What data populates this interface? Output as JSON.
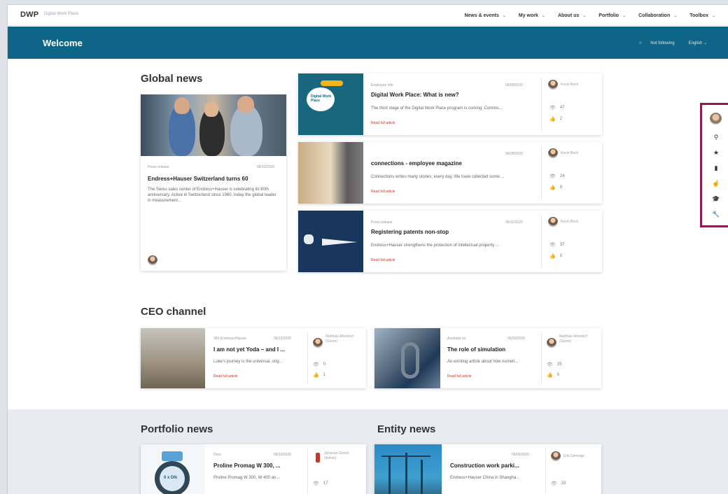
{
  "app": {
    "logo": "DWP",
    "subtitle": "Digital Work Place"
  },
  "topnav": {
    "items": [
      {
        "label": "News & events"
      },
      {
        "label": "My work"
      },
      {
        "label": "About us"
      },
      {
        "label": "Portfolio"
      },
      {
        "label": "Collaboration"
      },
      {
        "label": "Toolbox"
      }
    ]
  },
  "welcome": {
    "title": "Welcome",
    "follow_label": "Not following",
    "language": "English"
  },
  "global_news": {
    "title": "Global news",
    "main": {
      "meta_type": "Press release",
      "meta_date": "06/10/2020",
      "title": "Endress+Hauser Switzerland turns 60",
      "desc": "The Swiss sales center of Endress+Hauser is celebrating its 60th anniversary. Active in Switzerland since 1960, today the global leader in measurement..."
    },
    "items": [
      {
        "meta_type": "Employee info",
        "meta_date": "06/09/2020",
        "title": "Digital Work Place: What is new?",
        "desc": "The third stage of the Digital Work Place program is coming: Commu...",
        "read": "Read full article",
        "author": "Kevin Beck",
        "views": "47",
        "likes": "2",
        "thumb_text": "Digital Work Place"
      },
      {
        "meta_type": "",
        "meta_date": "06/08/2020",
        "title": "connections - employee magazine",
        "desc": "Connections writes many stories, every day. We have collected some ...",
        "read": "Read full article",
        "author": "Kevin Beck",
        "views": "24",
        "likes": "0"
      },
      {
        "meta_type": "Press release",
        "meta_date": "06/11/2020",
        "title": "Registering patents non-stop",
        "desc": "Endress+Hauser strengthens the protection of intellectual property ...",
        "read": "Read full article",
        "author": "Kevin Beck",
        "views": "37",
        "likes": "0"
      }
    ]
  },
  "ceo_channel": {
    "title": "CEO channel",
    "items": [
      {
        "meta_type": "360 Endress+Hauser",
        "meta_date": "06/10/2020",
        "title": "I am not yet Yoda – and I ...",
        "desc": "Luke's journey is the universal, orig...",
        "read": "Read full article",
        "author": "Matthias Altendorf (Genre)",
        "views": "0",
        "likes": "1"
      },
      {
        "meta_type": "Australia en",
        "meta_date": "06/02/2020",
        "title": "The role of simulation",
        "desc": "An exciting article about how numeri...",
        "read": "Read full article",
        "author": "Matthias Altendorf (Genre)",
        "views": "25",
        "likes": "0"
      }
    ]
  },
  "portfolio_news": {
    "title": "Portfolio news",
    "item": {
      "meta_type": "Flow",
      "meta_date": "06/10/2020",
      "title": "Proline Promag W 300, ...",
      "desc": "Proline Promag W 300, W 400 an...",
      "author": "Johanna Grimm (Admin)",
      "views": "17",
      "badge": "0 x DN"
    }
  },
  "entity_news": {
    "title": "Entity news",
    "item": {
      "meta_date": "06/09/2020",
      "title": "Construction work parki...",
      "desc": "Endress+Hauser China in Shangha...",
      "author": "Erik Demolge",
      "views": "33"
    }
  },
  "toolbar": {
    "icons": [
      "user-avatar",
      "search-icon",
      "star-icon",
      "bookmark-icon",
      "pointer-icon",
      "graduation-cap-icon",
      "wrench-icon"
    ]
  }
}
